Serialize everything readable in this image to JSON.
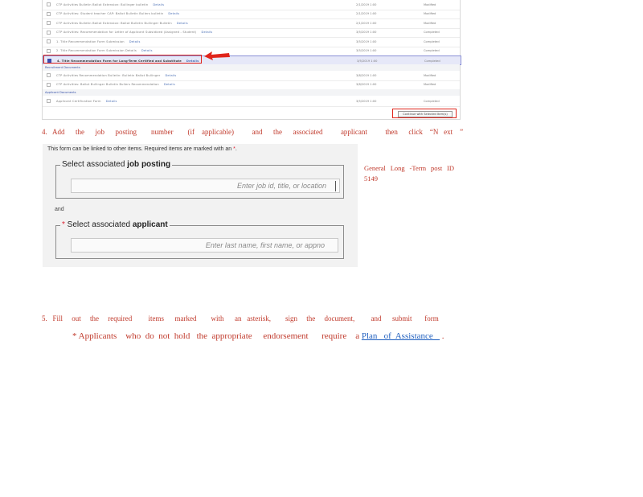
{
  "steps": {
    "step4": "4.   Add      the      job      posting        number        (if    applicable)          and      the      associated          applicant          then      click    “N   ext    ”",
    "step5": "5.   Fill     out     the     required         items      marked        with      an   asterisk,        sign     the     document,         and      submit       form",
    "note_prefix": "* Applicants    who  do  not  hold   the  appropriate     endorsement      require    a ",
    "note_link": "Plan   of  Assistance   ",
    "note_suffix": " ."
  },
  "side_text": "General     Long   -Term     post    ID 5149",
  "form": {
    "intro": "This form can be linked to other items. Required items are marked with an ",
    "intro_asterisk": "*",
    "intro_end": ".",
    "job_legend_prefix": "Select associated ",
    "job_legend_bold": "job posting",
    "job_placeholder": "Enter job id, title, or location",
    "and_text": "and",
    "applicant_required": "*",
    "applicant_legend_prefix": " Select associated ",
    "applicant_legend_bold": "applicant",
    "applicant_placeholder": "Enter last name, first name, or appno"
  },
  "doc_list": {
    "rows": [
      {
        "title": "CTP Activities Bulletin Ballot Extension: Bullinger bulletin",
        "link": "Details",
        "date": "2/1/2019 1:00",
        "status": "Modified"
      },
      {
        "title": "CTP Activities: Student teacher CAP: Ballot Bulletin Bullers bulletin",
        "link": "Details",
        "date": "2/1/2019 1:00",
        "status": "Modified"
      },
      {
        "title": "CTP Activities Bulletin Ballot Extension: Ballot Bulletin Bullinger Bulletin",
        "link": "Details",
        "date": "2/1/2019 1:00",
        "status": "Modified"
      },
      {
        "title": "CTP Activities: Recommendation for Letter of Applicant Subsidized (Assigned - Student)",
        "link": "Details",
        "date": "3/5/2019 1:00",
        "status": "Completed"
      },
      {
        "title": "1. Title Recommendation Form Submission",
        "link": "Details",
        "date": "3/5/2019 1:00",
        "status": "Completed"
      },
      {
        "title": "2. Title Recommendation Form Submission Details",
        "link": "Details",
        "date": "3/5/2019 1:00",
        "status": "Completed"
      }
    ],
    "highlighted_row": {
      "title": "4. Title Recommendation Form for Long-Term Certified and Substitute",
      "link": "Details",
      "date": "3/5/2019 1:00",
      "status": "Completed"
    },
    "group1": "Recruitment Documents",
    "rows2": [
      {
        "title": "CTP Activities Recommendation Bulletin: Bulletin Ballot Bullinger",
        "link": "Details",
        "date": "3/8/2019 1:00",
        "status": "Modified"
      },
      {
        "title": "CTP Activities: Ballot Bullinger Bulletin Bullers Recommendation",
        "link": "Details",
        "date": "3/8/2019 1:00",
        "status": "Modified"
      }
    ],
    "group2": "Applicant Documents",
    "rows3": [
      {
        "title": "Applicant Certification Form",
        "link": "Details",
        "date": "3/5/2019 1:00",
        "status": "Completed"
      }
    ],
    "group3": "",
    "button_label": "Continue with Selected Item(s)"
  }
}
